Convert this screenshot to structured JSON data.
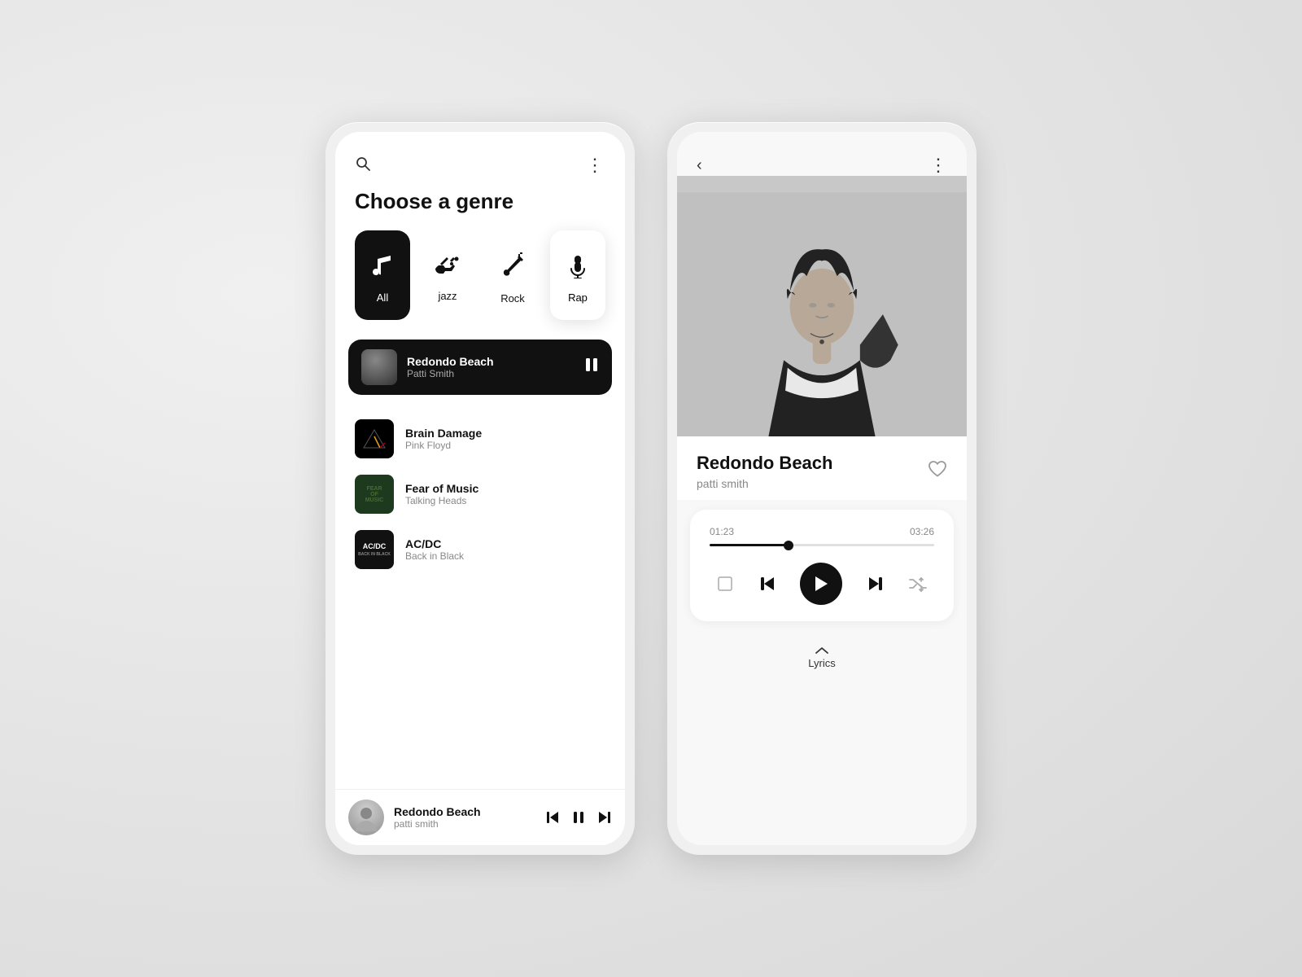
{
  "left_phone": {
    "header": {
      "search_icon": "🔍",
      "more_icon": "⋮"
    },
    "genre_section": {
      "title": "Choose a genre",
      "genres": [
        {
          "id": "all",
          "label": "All",
          "icon": "♩",
          "active": true
        },
        {
          "id": "jazz",
          "label": "jazz",
          "icon": "🎺",
          "active": false
        },
        {
          "id": "rock",
          "label": "Rock",
          "icon": "🎸",
          "active": false
        },
        {
          "id": "rap",
          "label": "Rap",
          "icon": "🎤",
          "active": false
        }
      ]
    },
    "now_playing": {
      "title": "Redondo Beach",
      "artist": "Patti Smith",
      "pause_icon": "⏸"
    },
    "song_list": [
      {
        "id": "brain-damage",
        "title": "Brain Damage",
        "artist": "Pink Floyd"
      },
      {
        "id": "fear-of-music",
        "title": "Fear of Music",
        "artist": "Talking Heads"
      },
      {
        "id": "acdc",
        "title": "AC/DC",
        "artist": "Back in Black"
      }
    ],
    "mini_player": {
      "title": "Redondo Beach",
      "artist": "patti smith",
      "prev_icon": "⏮",
      "pause_icon": "⏸",
      "next_icon": "⏭"
    }
  },
  "right_phone": {
    "header": {
      "back_icon": "<",
      "more_icon": "⋮"
    },
    "song_detail": {
      "title": "Redondo Beach",
      "artist": "patti smith",
      "heart_icon": "♡"
    },
    "player": {
      "current_time": "01:23",
      "total_time": "03:26",
      "progress_percent": 35,
      "repeat_icon": "⊡",
      "prev_icon": "⏮",
      "play_icon": "▶",
      "next_icon": "⏭",
      "shuffle_icon": "⇌"
    },
    "lyrics": {
      "chevron": "∧",
      "label": "Lyrics"
    }
  }
}
